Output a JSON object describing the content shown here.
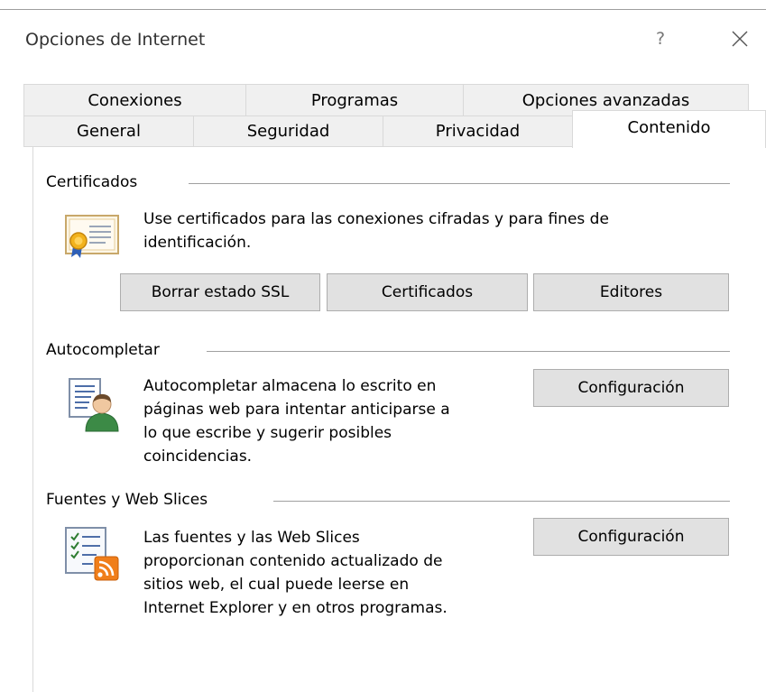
{
  "window": {
    "title": "Opciones de Internet",
    "help_label": "?"
  },
  "tabs": {
    "row_back": [
      "Conexiones",
      "Programas",
      "Opciones avanzadas"
    ],
    "row_front": [
      "General",
      "Seguridad",
      "Privacidad",
      "Contenido"
    ],
    "selected": "Contenido"
  },
  "certificates": {
    "title": "Certificados",
    "description_line1": "Use certificados para las conexiones cifradas y para fines de",
    "description_line2": "identificación.",
    "buttons": {
      "clear_ssl": "Borrar estado SSL",
      "certificates": "Certificados",
      "publishers": "Editores"
    },
    "icon": "certificate-icon"
  },
  "autocomplete": {
    "title": "Autocompletar",
    "description_lines": [
      "Autocompletar almacena lo escrito en",
      "páginas web para intentar anticiparse a",
      "lo que escribe y sugerir posibles",
      "coincidencias."
    ],
    "button": "Configuración",
    "icon": "autocomplete-user-icon"
  },
  "feeds": {
    "title": "Fuentes y Web Slices",
    "description_lines": [
      "Las fuentes y las Web Slices",
      "proporcionan contenido actualizado de",
      "sitios web, el cual puede leerse en",
      "Internet Explorer y en otros programas."
    ],
    "button": "Configuración",
    "icon": "rss-feed-icon"
  }
}
